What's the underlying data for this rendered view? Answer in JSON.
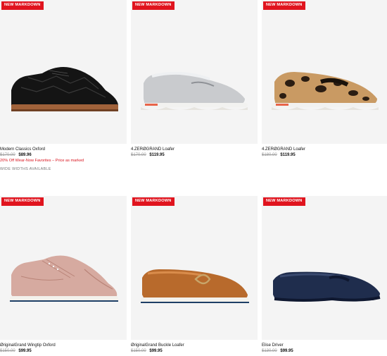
{
  "products": [
    {
      "badge": "NEW MARKDOWN",
      "name": "Modern Classics Oxford",
      "was": "$170.00",
      "now": "$89.96",
      "promo": "20% Off Wear-Now Favorites – Price as marked",
      "note": "WIDE WIDTHS AVAILABLE",
      "shoe_icon": "black-croc-oxford"
    },
    {
      "badge": "NEW MARKDOWN",
      "name": "4.ZERØGRAND Loafer",
      "was": "$170.00",
      "now": "$119.95",
      "shoe_icon": "silver-penny-loafer"
    },
    {
      "badge": "NEW MARKDOWN",
      "name": "4.ZERØGRAND Loafer",
      "was": "$180.00",
      "now": "$119.95",
      "shoe_icon": "leopard-penny-loafer"
    },
    {
      "badge": "NEW MARKDOWN",
      "name": "ØriginalGrand Wingtip Oxford",
      "was": "$150.00",
      "now": "$99.95",
      "shoe_icon": "rose-metallic-wingtip"
    },
    {
      "badge": "NEW MARKDOWN",
      "name": "ØriginalGrand Buckle Loafer",
      "was": "$150.00",
      "now": "$99.95",
      "shoe_icon": "tan-buckle-loafer"
    },
    {
      "badge": "NEW MARKDOWN",
      "name": "Elise Driver",
      "was": "$130.00",
      "now": "$99.95",
      "shoe_icon": "navy-driver"
    }
  ],
  "colors": {
    "badge": "#e0141e",
    "promo": "#d9141e",
    "tile_bg": "#f4f4f4"
  }
}
